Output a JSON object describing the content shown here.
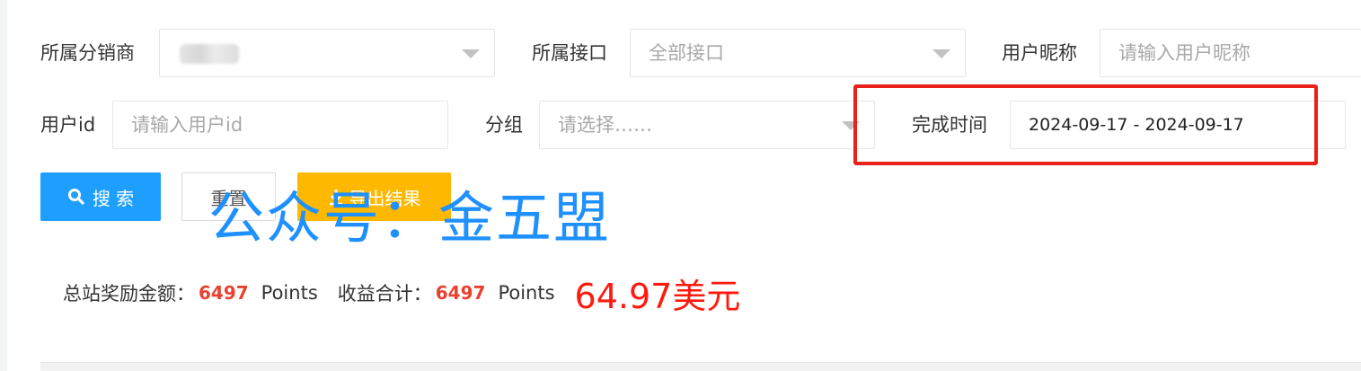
{
  "filters": {
    "distributor": {
      "label": "所属分销商"
    },
    "interface": {
      "label": "所属接口",
      "value": "全部接口"
    },
    "nickname": {
      "label": "用户昵称",
      "placeholder": "请输入用户昵称"
    },
    "user_id": {
      "label": "用户id",
      "placeholder": "请输入用户id"
    },
    "group": {
      "label": "分组",
      "placeholder": "请选择……"
    },
    "finish_time": {
      "label": "完成时间",
      "value": "2024-09-17 - 2024-09-17"
    }
  },
  "buttons": {
    "search": "搜 索",
    "reset": "重置",
    "export": "导出结果"
  },
  "watermark": "公众号：金五盟",
  "summary": {
    "total_reward_label": "总站奖励金额：",
    "total_reward_value": "6497",
    "total_reward_unit": "Points",
    "income_label": "收益合计：",
    "income_value": "6497",
    "income_unit": "Points",
    "usd_amount": "64.97美元"
  },
  "colors": {
    "primary": "#1e9fff",
    "warning": "#ffb800",
    "highlight": "#e8211b",
    "amount": "#e8412f"
  }
}
